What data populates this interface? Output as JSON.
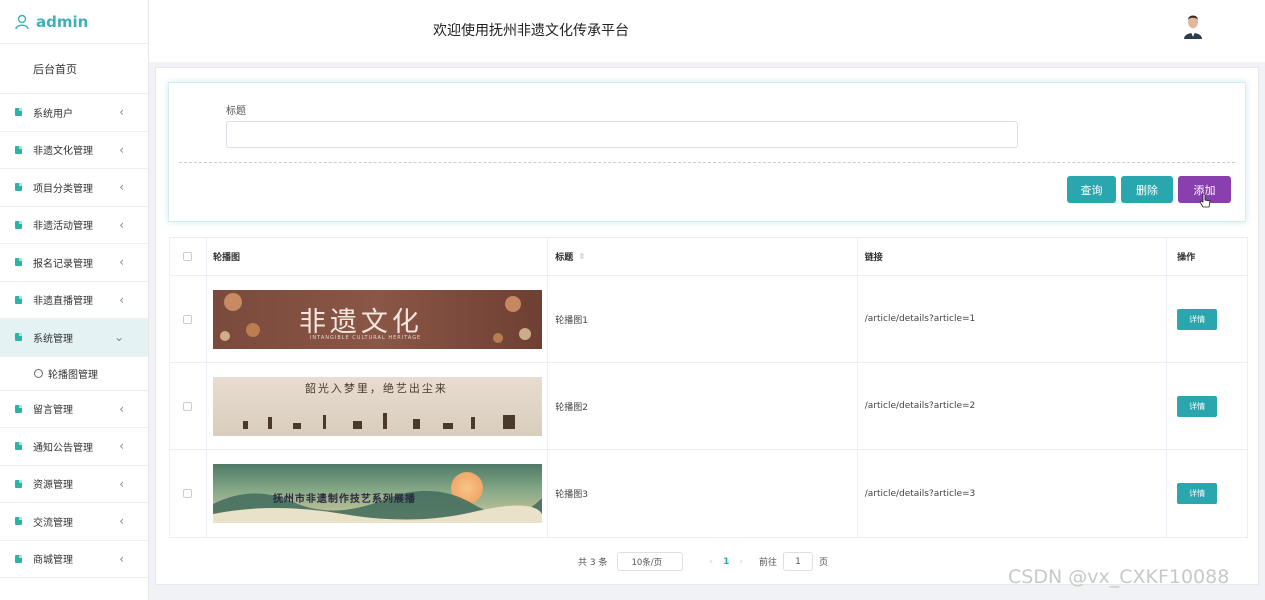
{
  "sidebar": {
    "brand": "admin",
    "home": "后台首页",
    "items": [
      {
        "label": "系统用户"
      },
      {
        "label": "非遗文化管理"
      },
      {
        "label": "项目分类管理"
      },
      {
        "label": "非遗活动管理"
      },
      {
        "label": "报名记录管理"
      },
      {
        "label": "非遗直播管理"
      },
      {
        "label": "系统管理"
      },
      {
        "label": "留言管理"
      },
      {
        "label": "通知公告管理"
      },
      {
        "label": "资源管理"
      },
      {
        "label": "交流管理"
      },
      {
        "label": "商城管理"
      }
    ],
    "submenu_label": "轮播图管理",
    "accent": "#2aa7ae",
    "active_bg": "#e4f2f3"
  },
  "header": {
    "title": "欢迎使用抚州非遗文化传承平台",
    "avatar_icon": "user-avatar"
  },
  "search": {
    "label": "标题",
    "input_value": "",
    "query_label": "查询",
    "delete_label": "删除",
    "add_label": "添加"
  },
  "table": {
    "headers": {
      "image": "轮播图",
      "title": "标题",
      "link": "链接",
      "actions": "操作"
    },
    "rows": [
      {
        "banner_text": "非遗文化",
        "banner_sub": "INTANGIBLE CULTURAL HERITAGE",
        "title": "轮播图1",
        "link": "/article/details?article=1",
        "action": "详情"
      },
      {
        "banner_text": "韶光入梦里，绝艺出尘来",
        "title": "轮播图2",
        "link": "/article/details?article=2",
        "action": "详情"
      },
      {
        "banner_text": "抚州市非遗制作技艺系列展播",
        "title": "轮播图3",
        "link": "/article/details?article=3",
        "action": "详情"
      }
    ]
  },
  "pagination": {
    "total": "共 3 条",
    "page_size": "10条/页",
    "current": "1",
    "goto_label": "前往",
    "goto_value": "1",
    "page_unit": "页"
  },
  "watermark": "CSDN @vx_CXKF10088"
}
